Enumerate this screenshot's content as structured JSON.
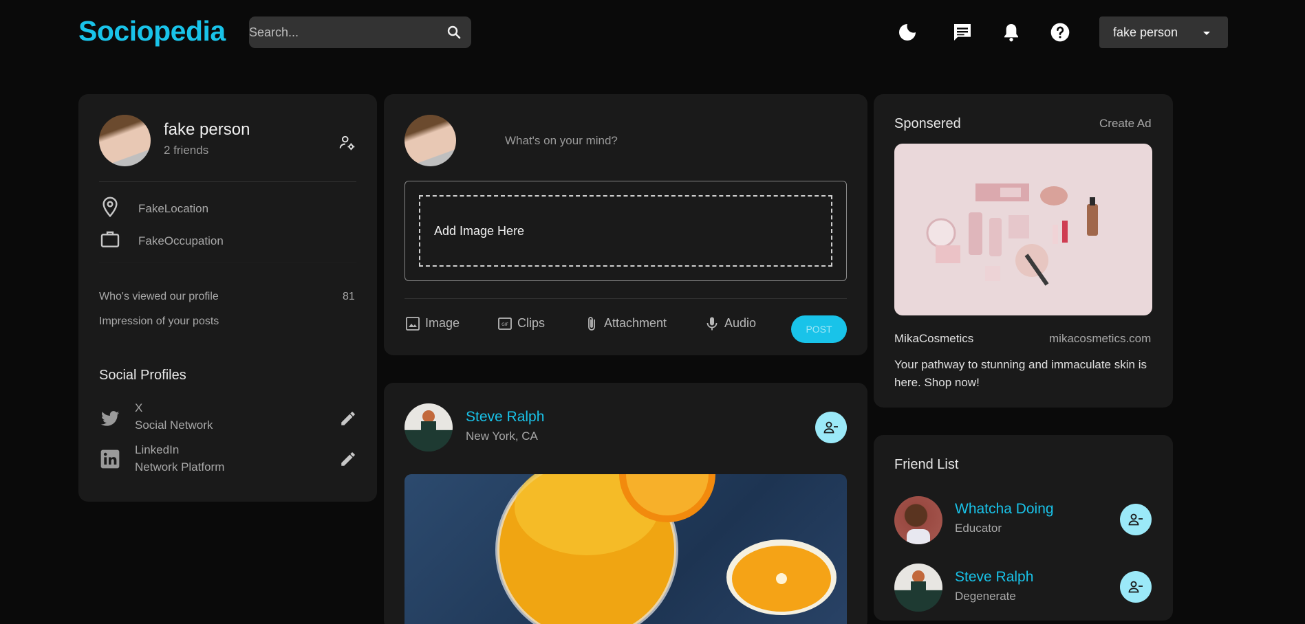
{
  "brand": "Sociopedia",
  "search": {
    "placeholder": "Search..."
  },
  "nav": {
    "icons": [
      "dark-mode-icon",
      "message-icon",
      "notifications-icon",
      "help-icon"
    ],
    "user_name": "fake person"
  },
  "profile": {
    "name": "fake person",
    "friends": "2 friends",
    "location": "FakeLocation",
    "occupation": "FakeOccupation",
    "viewed_label": "Who's viewed our profile",
    "viewed_value": "81",
    "impressions_label": "Impression of your posts",
    "social_title": "Social Profiles",
    "socials": [
      {
        "name": "X",
        "desc": "Social Network"
      },
      {
        "name": "LinkedIn",
        "desc": "Network Platform"
      }
    ]
  },
  "composer": {
    "placeholder": "What's on your mind?",
    "dropzone": "Add Image Here",
    "tools": [
      "Image",
      "Clips",
      "Attachment",
      "Audio"
    ],
    "post_label": "POST"
  },
  "feed_post": {
    "author": "Steve Ralph",
    "location": "New York, CA"
  },
  "sponsored": {
    "title": "Sponsered",
    "create": "Create Ad",
    "brand": "MikaCosmetics",
    "url": "mikacosmetics.com",
    "text": "Your pathway to stunning and immaculate skin is here. Shop now!"
  },
  "friend_list": {
    "title": "Friend List",
    "friends": [
      {
        "name": "Whatcha Doing",
        "role": "Educator"
      },
      {
        "name": "Steve Ralph",
        "role": "Degenerate"
      }
    ]
  },
  "colors": {
    "accent": "#19c3e9",
    "background": "#0a0a0a",
    "card": "#1a1a1a",
    "friend_button": "#9be9f8"
  }
}
